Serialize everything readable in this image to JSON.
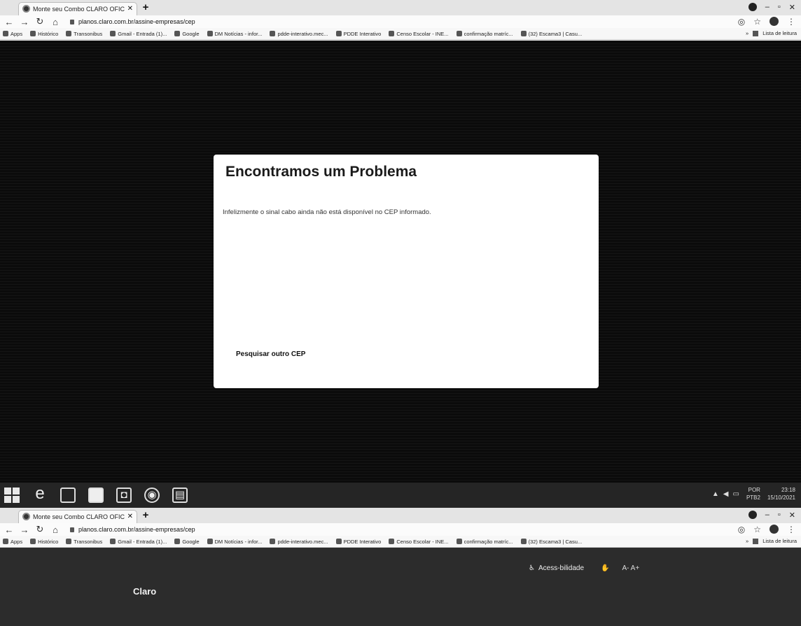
{
  "browser_top": {
    "tab_title": "Monte seu Combo CLARO OFIC",
    "url": "planos.claro.com.br/assine-empresas/cep",
    "bookmarks": [
      "Apps",
      "Histórico",
      "Transonibus",
      "Gmail - Entrada (1)...",
      "Google",
      "DM Notícias - infor...",
      "pdde-interativo.mec...",
      "PDDE Interativo",
      "Censo Escolar - INE...",
      "confirmação matríc...",
      "(32) Escama3 | Casu..."
    ],
    "reading_list": "Lista de leitura"
  },
  "modal": {
    "title": "Encontramos um Problema",
    "message": "Infelizmente o sinal cabo ainda não está disponível no CEP informado.",
    "link": "Pesquisar outro CEP"
  },
  "taskbar": {
    "lang": "POR",
    "lang_sub": "PTB2",
    "time": "23:18",
    "date": "15/10/2021"
  },
  "browser_bottom": {
    "tab_title": "Monte seu Combo CLARO OFIC",
    "url": "planos.claro.com.br/assine-empresas/cep",
    "bookmarks": [
      "Apps",
      "Histórico",
      "Transonibus",
      "Gmail - Entrada (1)...",
      "Google",
      "DM Notícias - infor...",
      "pdde-interativo.mec...",
      "PDDE Interativo",
      "Censo Escolar - INE...",
      "confirmação matríc...",
      "(32) Escama3 | Casu..."
    ],
    "reading_list": "Lista de leitura"
  },
  "page2": {
    "accessibility": "Acess-bilidade",
    "font_controls": "A- A+",
    "logo": "Claro"
  }
}
